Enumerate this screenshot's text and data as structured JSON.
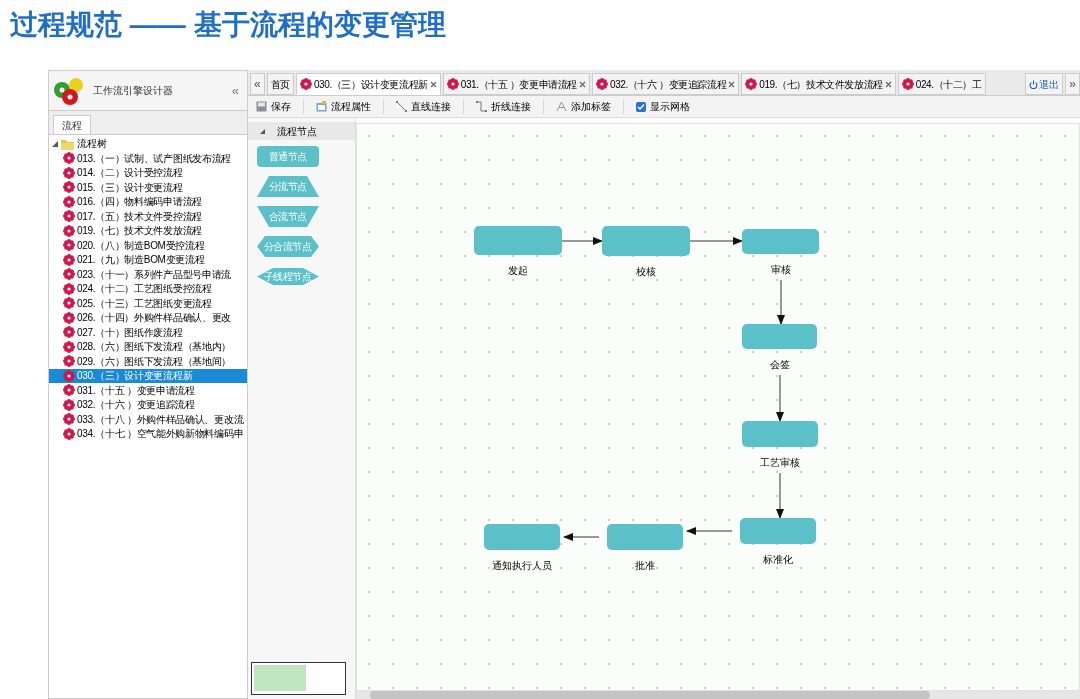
{
  "slide_title": "过程规范 —— 基于流程的变更管理",
  "designer": {
    "title": "工作流引擎设计器",
    "collapse": "«",
    "panel_tabs": [
      {
        "label": "流程",
        "selected": true
      }
    ],
    "tree": {
      "label": "流程树",
      "expanded": true,
      "children": [
        {
          "label": "013.（一）试制、试产图纸发布流程",
          "selected": false
        },
        {
          "label": "014.（二）设计受控流程",
          "selected": false
        },
        {
          "label": "015.（三）设计变更流程",
          "selected": false
        },
        {
          "label": "016.（四）物料编码申请流程",
          "selected": false
        },
        {
          "label": "017.（五）技术文件受控流程",
          "selected": false
        },
        {
          "label": "019.（七）技术文件发放流程",
          "selected": false
        },
        {
          "label": "020.（八）制造BOM受控流程",
          "selected": false
        },
        {
          "label": "021.（九）制造BOM变更流程",
          "selected": false
        },
        {
          "label": "023.（十一）系列件产品型号申请流",
          "selected": false
        },
        {
          "label": "024.（十二）工艺图纸受控流程",
          "selected": false
        },
        {
          "label": "025.（十三）工艺图纸变更流程",
          "selected": false
        },
        {
          "label": "026.（十四）外购件样品确认、更改",
          "selected": false
        },
        {
          "label": "027.（十）图纸作废流程",
          "selected": false
        },
        {
          "label": "028.（六）图纸下发流程（基地内）",
          "selected": false
        },
        {
          "label": "029.（六）图纸下发流程（基地间）",
          "selected": false
        },
        {
          "label": "030.（三）设计变更流程新",
          "selected": true
        },
        {
          "label": "031.（十五 ）变更申请流程",
          "selected": false
        },
        {
          "label": "032.（十六 ）变更追踪流程",
          "selected": false
        },
        {
          "label": "033.（十八 ）外购件样品确认、更改流",
          "selected": false
        },
        {
          "label": "034.（十七 ）空气能外购新物料编码申",
          "selected": false
        }
      ]
    }
  },
  "tabs": [
    {
      "label": "首页",
      "kind": "home",
      "selected": false,
      "closable": false
    },
    {
      "label": "030.（三）设计变更流程新",
      "kind": "process",
      "selected": true,
      "closable": true
    },
    {
      "label": "031.（十五 ）变更申请流程",
      "kind": "process",
      "selected": false,
      "closable": true
    },
    {
      "label": "032.（十六 ）变更追踪流程",
      "kind": "process",
      "selected": false,
      "closable": true
    },
    {
      "label": "019.（七）技术文件发放流程",
      "kind": "process",
      "selected": false,
      "closable": true
    },
    {
      "label": "024.（十二）工",
      "kind": "process",
      "selected": false,
      "closable": false
    }
  ],
  "logout": "退出",
  "tab_scroll": {
    "left": "«",
    "right": "»"
  },
  "toolbar": [
    {
      "label": "保存",
      "kind": "save"
    },
    {
      "label": "流程属性",
      "kind": "properties"
    },
    {
      "label": "直线连接",
      "kind": "line"
    },
    {
      "label": "折线连接",
      "kind": "polyline"
    },
    {
      "label": "添加标签",
      "kind": "label"
    },
    {
      "label": "显示网格",
      "kind": "checkbox",
      "checked": true
    }
  ],
  "palette": {
    "title": "流程节点",
    "expanded": true,
    "nodes": [
      {
        "label": "普通节点",
        "kind": "normal"
      },
      {
        "label": "分流节点",
        "kind": "split"
      },
      {
        "label": "合流节点",
        "kind": "merge"
      },
      {
        "label": "分合流节点",
        "kind": "splitmerge"
      },
      {
        "label": "子线程节点",
        "kind": "subthread"
      }
    ]
  },
  "canvas": {
    "nodes": [
      {
        "label": "发起"
      },
      {
        "label": "校核"
      },
      {
        "label": "审核"
      },
      {
        "label": "会签"
      },
      {
        "label": "工艺审核"
      },
      {
        "label": "标准化"
      },
      {
        "label": "批准"
      },
      {
        "label": "通知执行人员"
      }
    ]
  }
}
